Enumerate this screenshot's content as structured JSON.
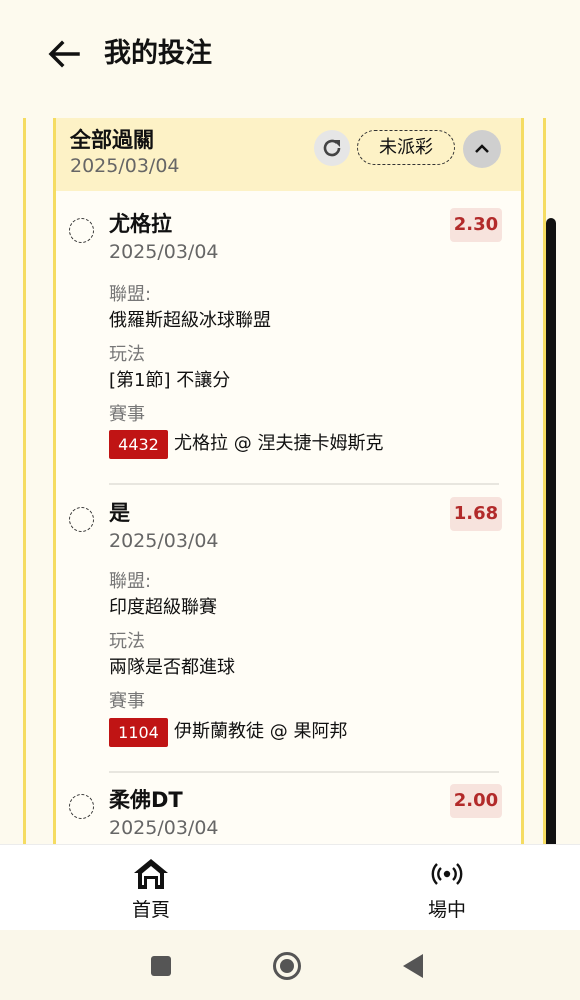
{
  "header": {
    "title": "我的投注",
    "back_icon": "back-arrow-icon"
  },
  "bet": {
    "type": "全部過關",
    "date": "2025/03/04",
    "status": "未派彩",
    "refresh_icon": "refresh-icon",
    "collapse_icon": "chevron-up-icon",
    "labels": {
      "league": "聯盟:",
      "market": "玩法",
      "event": "賽事"
    },
    "legs": [
      {
        "selection": "尤格拉",
        "date": "2025/03/04",
        "odds": "2.30",
        "league": "俄羅斯超級冰球聯盟",
        "market": "[第1節] 不讓分",
        "match_code": "4432",
        "match": "尤格拉 @ 涅夫捷卡姆斯克"
      },
      {
        "selection": "是",
        "date": "2025/03/04",
        "odds": "1.68",
        "league": "印度超級聯賽",
        "market": "兩隊是否都進球",
        "match_code": "1104",
        "match": "伊斯蘭教徒 @ 果阿邦"
      },
      {
        "selection": "柔佛DT",
        "date": "2025/03/04",
        "odds": "2.00"
      }
    ]
  },
  "nav": {
    "home": "首頁",
    "live": "場中",
    "home_icon": "home-icon",
    "live_icon": "broadcast-icon"
  },
  "system_nav": {
    "icons": [
      "recents-square-icon",
      "home-circle-icon",
      "back-triangle-icon"
    ]
  },
  "colors": {
    "accent_border": "#f5dc62",
    "header_bg": "#fdf2c6",
    "odds_text": "#b22a2a",
    "odds_bg": "#f7e3dd",
    "match_badge": "#c01414"
  }
}
